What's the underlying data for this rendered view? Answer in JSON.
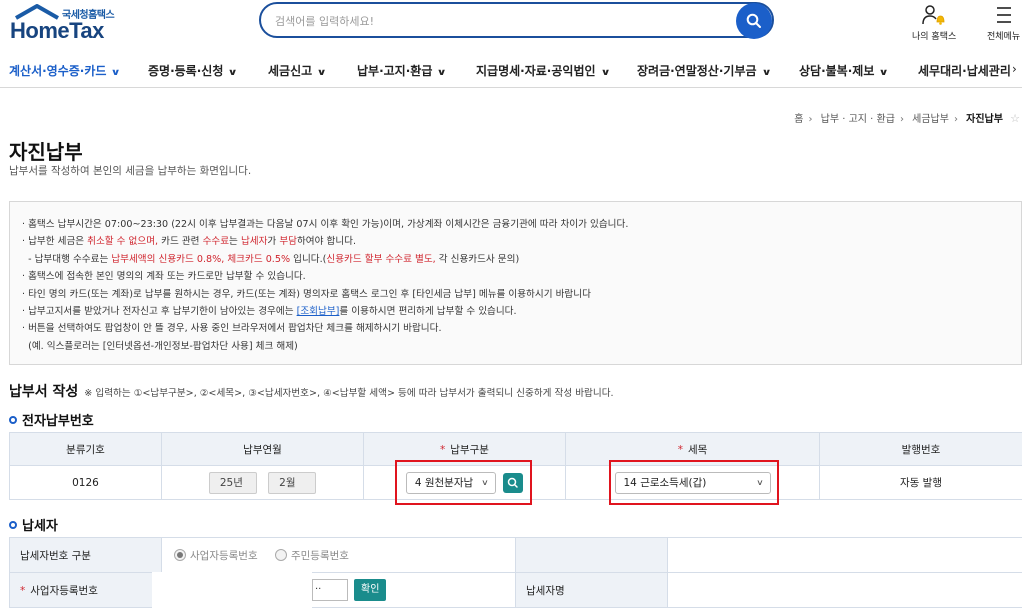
{
  "header": {
    "logo_sub": "국세청홈택스",
    "logo_main": "HomeTax",
    "search_placeholder": "검색어를 입력하세요!",
    "my_hometax": "나의 홈택스",
    "all_menu": "전체메뉴"
  },
  "gnb": [
    "계산서·영수증·카드",
    "증명·등록·신청",
    "세금신고",
    "납부·고지·환급",
    "지급명세·자료·공익법인",
    "장려금·연말정산·기부금",
    "상담·불복·제보",
    "세무대리·납세관리"
  ],
  "breadcrumb": [
    "홈",
    "납부 · 고지 · 환급",
    "세금납부",
    "자진납부"
  ],
  "page": {
    "title": "자진납부",
    "desc": "납부서를 작성하여 본인의 세금을 납부하는 화면입니다."
  },
  "notice": {
    "l1": "· 홈택스 납부시간은 07:00~23:30 (22시 이후 납부결과는 다음날 07시 이후 확인 가능)이며, 가상계좌 이체시간은 금융기관에 따라 차이가 있습니다.",
    "l2a": "· 납부한 세금은 ",
    "l2b": "취소할 수 없으며,",
    "l2c": " 카드 관련 ",
    "l2d": "수수료",
    "l2e": "는 ",
    "l2f": "납세자",
    "l2g": "가 ",
    "l2h": "부담",
    "l2i": "하여야 합니다.",
    "l3a": "  - 납부대행 수수료는 ",
    "l3b": "납부세액의 신용카드 0.8%, 체크카드 0.5%",
    "l3c": " 입니다.(",
    "l3d": "신용카드 할부 수수료 별도,",
    "l3e": " 각 신용카드사 문의)",
    "l4": "· 홈택스에 접속한 본인 명의의 계좌 또는 카드로만 납부할 수 있습니다.",
    "l5": "· 타인 명의 카드(또는 계좌)로 납부를 원하시는 경우, 카드(또는 계좌) 명의자로 홈택스 로그인 후 [타인세금 납부] 메뉴를 이용하시기 바랍니다",
    "l6a": "· 납부고지서를 받았거나 전자신고 후 납부기한이 남아있는 경우에는 ",
    "l6b": "[조회납부]",
    "l6c": "를 이용하시면 편리하게  납부할 수 있습니다.",
    "l7": "· 버튼을 선택하여도 팝업창이 안 뜰 경우, 사용 중인 브라우저에서 팝업차단 체크를 해제하시기 바랍니다.",
    "l8": "  (예. 익스플로러는 [인터넷옵션-개인정보-팝업차단 사용] 체크 해제)"
  },
  "form": {
    "title": "납부서 작성",
    "note": "※ 입력하는 ①<납부구분>, ②<세목>, ③<납세자번호>, ④<납부할 세액> 등에 따라 납부서가 출력되니 신중하게 작성 바랍니다."
  },
  "enum_section": {
    "title": "전자납부번호",
    "headers": [
      "분류기호",
      "납부연월",
      "납부구분",
      "세목",
      "발행번호"
    ],
    "code": "0126",
    "year": "25년",
    "month": "2월",
    "pay_type": "4 원천분자납",
    "tax_item": "14 근로소득세(갑)",
    "issue": "자동 발행"
  },
  "taxpayer_section": {
    "title": "납세자",
    "row1_label": "납세자번호 구분",
    "opt_business": "사업자등록번호",
    "opt_resident": "주민등록번호",
    "row2_label": "사업자등록번호",
    "masked": "··",
    "confirm": "확인",
    "name_label": "납세자명"
  },
  "colors": {
    "brand": "#1b5fc9",
    "teal": "#1a8c8c",
    "highlight": "#e0141e"
  }
}
